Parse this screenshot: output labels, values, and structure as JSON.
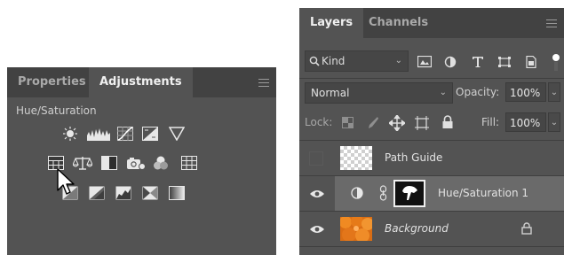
{
  "adjustments_panel": {
    "tabs": [
      "Properties",
      "Adjustments"
    ],
    "active_tab": "Adjustments",
    "section_title": "Hue/Saturation",
    "icon_rows": [
      [
        "brightness-contrast-icon",
        "levels-icon",
        "curves-icon",
        "exposure-icon",
        "triangle-icon"
      ],
      [
        "hue-saturation-icon",
        "color-balance-icon",
        "black-white-icon",
        "photo-filter-icon",
        "channel-mixer-icon",
        "color-lookup-icon"
      ],
      [
        "invert-icon",
        "posterize-icon",
        "threshold-icon",
        "selective-color-icon",
        "gradient-map-icon"
      ]
    ]
  },
  "layers_panel": {
    "tabs": [
      "Layers",
      "Channels"
    ],
    "active_tab": "Layers",
    "filter": {
      "label": "Kind"
    },
    "blend_mode": "Normal",
    "opacity_label": "Opacity:",
    "opacity_value": "100%",
    "lock_label": "Lock:",
    "fill_label": "Fill:",
    "fill_value": "100%",
    "layers": [
      {
        "name": "Path Guide",
        "visible": false
      },
      {
        "name": "Hue/Saturation 1",
        "visible": true
      },
      {
        "name": "Background",
        "visible": true,
        "locked": true
      }
    ]
  },
  "colors": {
    "panel_bg": "#535353",
    "tabbar_bg": "#424242",
    "selected_layer": "#6a6a6a",
    "background_thumb": "#e07a1e"
  }
}
